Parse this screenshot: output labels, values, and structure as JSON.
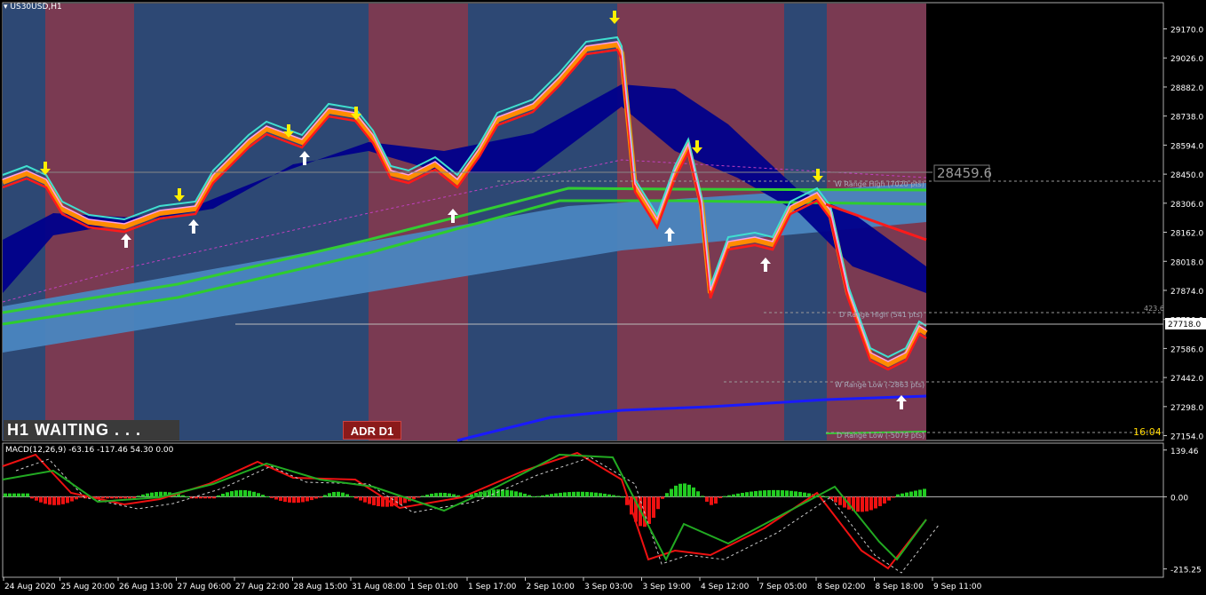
{
  "window": {
    "symbol": "US30USD,H1",
    "status": "H1  WAITING . . .",
    "adr_label": "ADR D1",
    "timer": "16:04"
  },
  "chart_data": {
    "type": "line",
    "price_axis": {
      "ticks": [
        "29170.0",
        "29026.0",
        "28882.0",
        "28738.0",
        "28594.0",
        "28450.0",
        "28306.0",
        "28162.0",
        "28018.0",
        "27874.0",
        "27730.0",
        "27586.0",
        "27442.0",
        "27298.0",
        "27154.0"
      ],
      "tick_values": [
        29170,
        29026,
        28882,
        28738,
        28594,
        28450,
        28306,
        28162,
        28018,
        27874,
        27730,
        27586,
        27442,
        27298,
        27154
      ],
      "ylim": [
        27130,
        29300
      ]
    },
    "current_price": "27718.0",
    "price_label_box": "28459.6",
    "level_label_right": "423.6",
    "range_labels": [
      "W Range High (7020 pts)",
      "D Range High (541 pts)",
      "W Range Low (-2863 pts)",
      "D Range Low (-5079 pts)"
    ],
    "time_axis": [
      "24 Aug 2020",
      "25 Aug 20:00",
      "26 Aug 13:00",
      "27 Aug 06:00",
      "27 Aug 22:00",
      "28 Aug 15:00",
      "31 Aug 08:00",
      "1 Sep 01:00",
      "1 Sep 17:00",
      "2 Sep 10:00",
      "3 Sep 03:00",
      "3 Sep 19:00",
      "4 Sep 12:00",
      "7 Sep 05:00",
      "8 Sep 02:00",
      "8 Sep 18:00",
      "9 Sep 11:00"
    ],
    "macd": {
      "label": "MACD(12,26,9) -63.16 -117.46 54.30 0.00",
      "ticks": [
        "139.46",
        "0.00",
        "-215.25"
      ],
      "tick_values": [
        139.46,
        0,
        -215.25
      ],
      "ylim": [
        -240,
        160
      ]
    },
    "colors": {
      "session_blue": "#2d4874",
      "session_red": "#7a3a52",
      "cloud_blue": "#00008b",
      "band_light": "#4a86c0",
      "ma_green": "#32cd32",
      "ma_red": "#ff1a1a",
      "ma_cyan": "#40e0d0",
      "ma_orange": "#ff8c00",
      "ma_blue": "#1a1aff",
      "hist_pos": "#22cc22",
      "hist_neg": "#ee1111",
      "arrow_down": "#ffee00",
      "arrow_up": "#ffffff"
    }
  }
}
